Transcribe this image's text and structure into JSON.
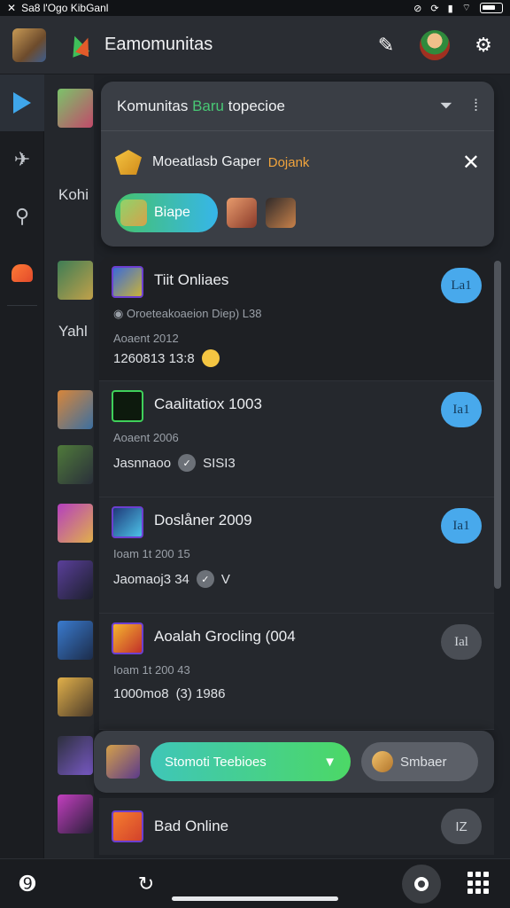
{
  "status_bar": {
    "app_label": "Sa8 l'Ogo KibGanl"
  },
  "header": {
    "title": "Eamomunitas"
  },
  "side": {
    "label_1": "Kohi",
    "label_2": "Yahl"
  },
  "community_card": {
    "title_prefix": "Komunitas",
    "title_highlight": "Baru",
    "title_suffix": "topecioe",
    "gamer_name": "Moeatlasb Gaper",
    "gamer_tag": "Dojank",
    "join_pill": "Biape"
  },
  "lobbies": [
    {
      "name": "Tiit Onliaes",
      "meta1": "Oroeteakoaeion Diep) L38",
      "meta2a": "Aoaent 2012",
      "meta2b": "1260813 13:8",
      "join": "La1"
    },
    {
      "name": "Caalitatiox 1003",
      "meta1": "Aoaent 2006",
      "meta2": "Jasnnaoo",
      "meta2_suffix": "SISI3",
      "join": "Ia1"
    },
    {
      "name": "Doslåner 2009",
      "meta1": "Ioam 1t 200 15",
      "meta2": "Jaomaoj3 34",
      "meta2_suffix": "V",
      "join": "Ia1"
    },
    {
      "name": "Aoalah Grocling (004",
      "meta1": "Ioam 1t 200 43",
      "meta2": "1000mo8",
      "meta2_suffix": "(3) 1986",
      "join": "Ial"
    }
  ],
  "cta": {
    "primary": "Stomoti Teebioes",
    "secondary": "Smbaer"
  },
  "last_row": {
    "name": "Bad Online",
    "join": "IZ"
  }
}
